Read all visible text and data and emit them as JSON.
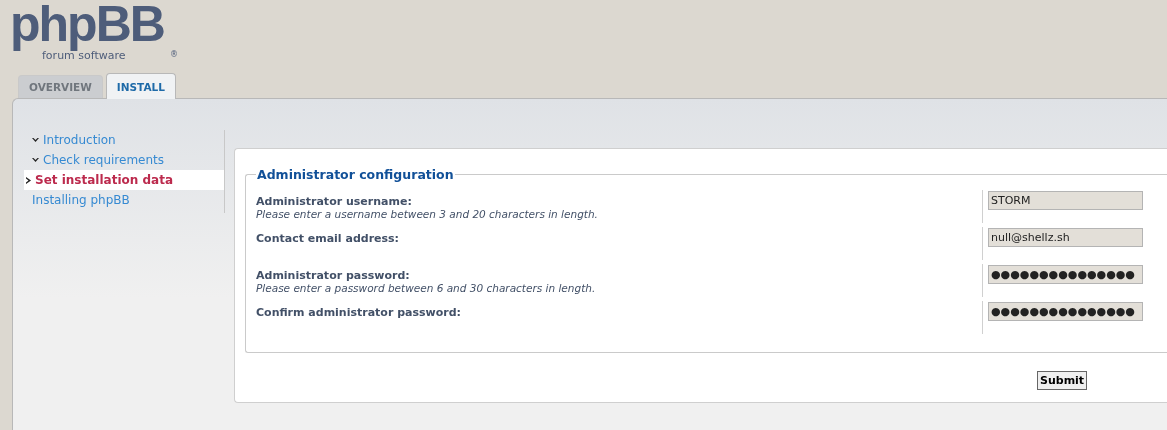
{
  "logo": {
    "name": "phpBB",
    "tagline": "forum software",
    "mark": "®"
  },
  "tabs": [
    {
      "label": "OVERVIEW",
      "selected": false
    },
    {
      "label": "INSTALL",
      "selected": true
    }
  ],
  "sidebar": {
    "items": [
      {
        "label": "Introduction",
        "kind": "done",
        "selected": false
      },
      {
        "label": "Check requirements",
        "kind": "done",
        "selected": false
      },
      {
        "label": "Set installation data",
        "kind": "current",
        "selected": true
      },
      {
        "label": "Installing phpBB",
        "kind": "pending",
        "selected": false
      }
    ]
  },
  "form": {
    "legend": "Administrator configuration",
    "fields": [
      {
        "label": "Administrator username:",
        "hint": "Please enter a username between 3 and 20 characters in length.",
        "value": "STORM"
      },
      {
        "label": "Contact email address:",
        "value": "null@shellz.sh"
      },
      {
        "label": "Administrator password:",
        "hint": "Please enter a password between 6 and 30 characters in length.",
        "value": "●●●●●●●●●●●●●●●"
      },
      {
        "label": "Confirm administrator password:",
        "value": "●●●●●●●●●●●●●●●"
      }
    ]
  },
  "submit": "Submit"
}
